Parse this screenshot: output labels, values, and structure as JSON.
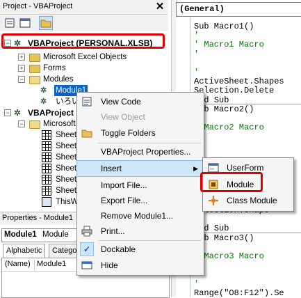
{
  "project_pane": {
    "title": "Project - VBAProject",
    "close_label": "✕",
    "tree": {
      "personal_project": "VBAProject (PERSONAL.XLSB)",
      "ms_excel_objects": "Microsoft Excel Objects",
      "forms": "Forms",
      "modules": "Modules",
      "module1": "Module1",
      "iroha": "いろい",
      "project2": "VBAProject",
      "microsoft": "Microsoft",
      "sheets": [
        "Sheet",
        "Sheet",
        "Sheet",
        "Sheet",
        "Sheet",
        "Sheet"
      ],
      "thisworkbook": "ThisW"
    }
  },
  "properties_pane": {
    "title": "Properties - Module1",
    "combo_bold": "Module1",
    "combo_type": "Module",
    "tab_alphabetic": "Alphabetic",
    "tab_categorized": "Catego",
    "name_key": "(Name)",
    "name_value": "Module1"
  },
  "code_window": {
    "object_combo": "(General)",
    "lines": [
      "Sub Macro1()",
      "'",
      "' Macro1 Macro",
      "'",
      "",
      "'",
      "    ActiveSheet.Shapes",
      "    Selection.Delete",
      "End Sub",
      "Sub Macro2()",
      "'",
      "' Macro2 Macro",
      "'",
      "",
      "'",
      "    ActiveSheet.Shape",
      "",
      "",
      "",
      "",
      "    Selection.Shape",
      "",
      "End Sub",
      "Sub Macro3()",
      "'",
      "' Macro3 Macro",
      "'",
      "",
      "'",
      "    Range(\"O8:F12\").Se"
    ]
  },
  "context_menu": {
    "view_code": "View Code",
    "view_object": "View Object",
    "toggle_folders": "Toggle Folders",
    "vbaproject_properties": "VBAProject Properties...",
    "insert": "Insert",
    "import_file": "Import File...",
    "export_file": "Export File...",
    "remove_module": "Remove Module1...",
    "print": "Print...",
    "dockable": "Dockable",
    "hide": "Hide"
  },
  "insert_submenu": {
    "userform": "UserForm",
    "module": "Module",
    "class_module": "Class Module"
  },
  "colors": {
    "highlight_red": "#e00000",
    "menu_highlight": "#cde6f7",
    "comment_green": "#007800"
  }
}
